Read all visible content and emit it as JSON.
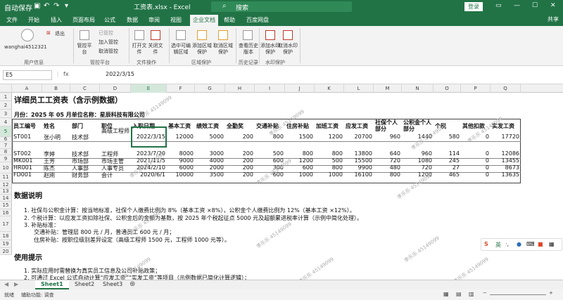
{
  "titlebar": {
    "autosave": "自动保存",
    "title": "工资表.xlsx - Excel",
    "search": "搜索",
    "login": "登录"
  },
  "menu": {
    "items": [
      "文件",
      "开始",
      "插入",
      "页面布局",
      "公式",
      "数据",
      "审阅",
      "视图",
      "企业文档",
      "帮助",
      "百度网盘"
    ],
    "active": "企业文档",
    "share": "共享"
  },
  "ribbon": {
    "user": "wanghai4512321",
    "logout": "退出",
    "btn_manage": "管控平台",
    "btn_already": "已管控",
    "btn_add": "加入管控",
    "btn_cancel": "取消管控",
    "btn_open": "打开文件",
    "btn_close": "关闭文件",
    "btn_sel": "选中可编辑区域",
    "btn_add_region": "添加区域保护",
    "btn_cancel_region": "取消区域保护",
    "btn_history": "查看历史版本",
    "btn_add_wm": "添加水印保护",
    "btn_cancel_wm": "取消水印保护",
    "groups": [
      "用户信息",
      "管控平台",
      "文件操作",
      "区域保护",
      "历史记录",
      "水印保护"
    ]
  },
  "formula": {
    "namebox": "E5",
    "fx": "fx",
    "value": "2022/3/15"
  },
  "columns": [
    "A",
    "B",
    "C",
    "D",
    "E",
    "F",
    "G",
    "H",
    "I",
    "J",
    "K",
    "L",
    "M",
    "N",
    "O",
    "P",
    "Q"
  ],
  "rows": [
    "1",
    "2",
    "3",
    "4",
    "5",
    "6",
    "7",
    "8",
    "9",
    "10",
    "11",
    "12",
    "13",
    "14",
    "15",
    "16",
    "17",
    "18",
    "19",
    "20"
  ],
  "sheet": {
    "title": "详细员工工资表（含示例数据）",
    "month_line": "月份：2025 年 05 月单位名称：星辰科技有限公司",
    "headers": [
      "员工编号",
      "姓名",
      "部门",
      "职位",
      "入职日期",
      "基本工资",
      "绩效工资",
      "全勤奖",
      "交通补贴",
      "住房补贴",
      "加班工资",
      "应发工资",
      "社保个人部分",
      "公积金个人部分",
      "个税",
      "其他扣款",
      "实发工资"
    ],
    "data": [
      [
        "ST001",
        "张小明",
        "技术部",
        "高级工程师",
        "2022/3/15",
        "12000",
        "5000",
        "200",
        "800",
        "1500",
        "1200",
        "20700",
        "960",
        "1440",
        "580",
        "0",
        "17720"
      ],
      [
        "ST002",
        "李婷",
        "技术部",
        "工程师",
        "2023/7/20",
        "8000",
        "3000",
        "200",
        "500",
        "800",
        "800",
        "13800",
        "640",
        "960",
        "114",
        "0",
        "12086"
      ],
      [
        "MK001",
        "王芳",
        "市场部",
        "市场主管",
        "2021/11/5",
        "9000",
        "4000",
        "200",
        "600",
        "1200",
        "500",
        "15500",
        "720",
        "1080",
        "245",
        "0",
        "13455"
      ],
      [
        "HR001",
        "陈杰",
        "人事部",
        "人事专员",
        "2024/2/10",
        "6000",
        "2000",
        "200",
        "300",
        "600",
        "800",
        "9900",
        "480",
        "720",
        "27",
        "0",
        "8673"
      ],
      [
        "FD001",
        "赵刚",
        "财务部",
        "会计",
        "2020/6/1",
        "10000",
        "3500",
        "200",
        "600",
        "1000",
        "1000",
        "16100",
        "800",
        "1200",
        "465",
        "0",
        "13635"
      ]
    ],
    "section1": "数据说明",
    "note1": "1.   社保与公积金计算：按当地标准，社保个人缴费比例为 8%（基本工资 ×8%），公积金个人缴费比例为 12%（基本工资 ×12%）。",
    "note2": "2.   个税计算：以应发工资扣除社保、公积金后的金额为基数，按 2025 年个税起征点 5000 元及超额累进税率计算（示例中简化处理）。",
    "note3": "3.   补贴标准：",
    "note3a": "交通补贴：管理层 800 元 / 月，普通员工 600 元 / 月；",
    "note3b": "住房补贴：按职位级别差异设定（高级工程师 1500 元，工程师 1000 元等）。",
    "section2": "使用提示",
    "tip1": "1.   实际应用时需替换为真实员工信息及公司补贴政策；",
    "tip2": "2.   可通过 Excel 公式自动计算“应发工资”“实发工资”等项目（示例数据已简化计算逻辑）；"
  },
  "watermark": "李乐乐 45149099",
  "sheets": [
    "Sheet1",
    "Sheet2",
    "Sheet3"
  ],
  "status": {
    "ready": "就绪",
    "access": "辅助功能: 调查"
  },
  "ime": {
    "lang": "英"
  }
}
